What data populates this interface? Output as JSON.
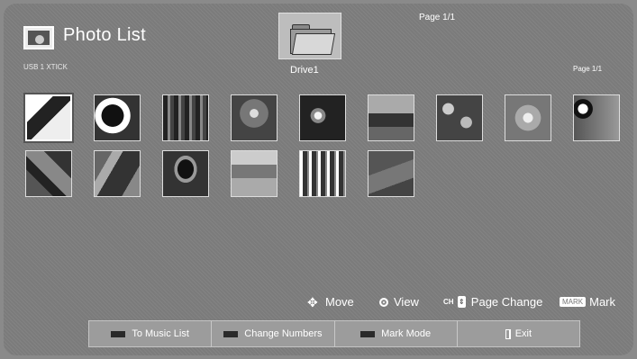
{
  "header": {
    "title": "Photo List",
    "device": "USB 1 XTICK",
    "folder_label": "Drive1",
    "page_top": "Page 1/1",
    "page_right": "Page 1/1"
  },
  "thumbnails": [
    {
      "name": "photo-1"
    },
    {
      "name": "photo-2"
    },
    {
      "name": "photo-3"
    },
    {
      "name": "photo-4"
    },
    {
      "name": "photo-5"
    },
    {
      "name": "photo-6"
    },
    {
      "name": "photo-7"
    },
    {
      "name": "photo-8"
    },
    {
      "name": "photo-9"
    },
    {
      "name": "photo-10"
    },
    {
      "name": "photo-11"
    },
    {
      "name": "photo-12"
    },
    {
      "name": "photo-13"
    },
    {
      "name": "photo-14"
    },
    {
      "name": "photo-15"
    }
  ],
  "controls": {
    "move": "Move",
    "view": "View",
    "ch_label": "CH",
    "page_change": "Page Change",
    "mark_badge": "MARK",
    "mark": "Mark"
  },
  "footer": {
    "to_music_list": "To Music List",
    "change_numbers": "Change Numbers",
    "mark_mode": "Mark Mode",
    "exit": "Exit"
  },
  "colors": {
    "background": "#7b7b7b",
    "footer_swatch": "#2a2a2a"
  }
}
